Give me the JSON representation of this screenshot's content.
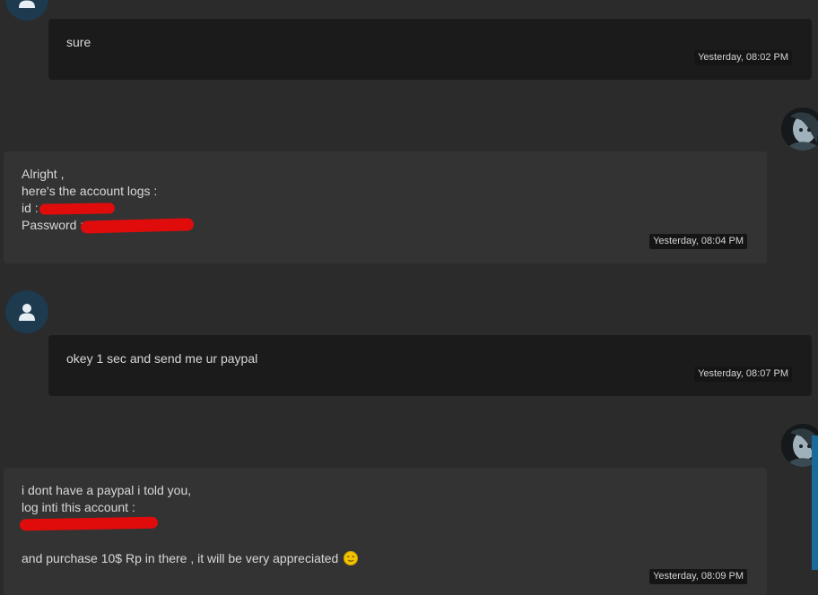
{
  "messages": [
    {
      "lines": [
        "sure"
      ],
      "time": "Yesterday, 08:02 PM"
    },
    {
      "lines": [
        "Alright ,",
        "here's the account logs :",
        "id :",
        "Password :"
      ],
      "time": "Yesterday, 08:04 PM"
    },
    {
      "lines": [
        "okey 1 sec and send me ur paypal"
      ],
      "time": "Yesterday, 08:07 PM"
    },
    {
      "lines": [
        "i dont have a paypal i told you,",
        "log inti this account :",
        "",
        "",
        "and purchase 10$ Rp in there , it will be very appreciated"
      ],
      "time": "Yesterday, 08:09 PM"
    }
  ],
  "icons": {
    "user_avatar": "user-silhouette-icon",
    "emoji": "smiling-face-icon"
  },
  "colors": {
    "background": "#2b2b2b",
    "outgoing_bubble": "#1b1b1b",
    "incoming_bubble": "#333333",
    "avatar_bg": "#1d3a4f",
    "redaction": "#e00c0c",
    "scrollbar": "#1a6a9a"
  }
}
